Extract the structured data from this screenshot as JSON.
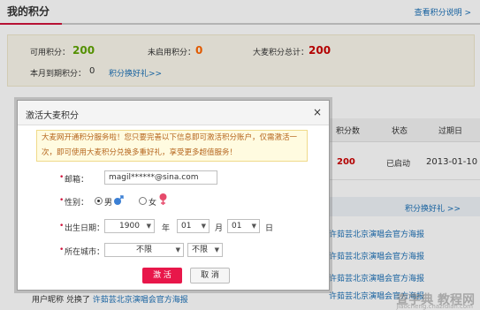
{
  "header": {
    "title": "我的积分",
    "help_link": "查看积分说明 >"
  },
  "summary": {
    "available_label": "可用积分：",
    "available_value": "200",
    "inactive_label": "未启用积分：",
    "inactive_value": "0",
    "total_label": "大麦积分总计：",
    "total_value": "200",
    "expire_label": "本月到期积分：",
    "expire_value": "0",
    "exchange_link": "积分换好礼>>"
  },
  "table": {
    "headers": [
      "积分数",
      "状态",
      "过期日"
    ],
    "row": {
      "points": "200",
      "status": "已启动",
      "expire": "2013-01-10"
    },
    "exchange_link": "积分换好礼 >>"
  },
  "feed": [
    {
      "prefix": "",
      "action": "",
      "item": "许茹芸北京演唱会官方海报"
    },
    {
      "prefix": "",
      "action": "",
      "item": "许茹芸北京演唱会官方海报"
    },
    {
      "prefix": "",
      "action": "",
      "item": "许茹芸北京演唱会官方海报"
    },
    {
      "prefix": "",
      "action": "",
      "item": "许茹芸北京演唱会官方海报"
    },
    {
      "prefix": "用户昵称",
      "action": "兑换了",
      "item": "许茹芸北京演唱会官方海报"
    }
  ],
  "dialog": {
    "title": "激活大麦积分",
    "close": "×",
    "notice": "大麦网开通积分服务啦！您只要完善以下信息即可激活积分账户，仅需激活一次，即可使用大麦积分兑换多重好礼，享受更多超值服务！",
    "email_label": "邮箱：",
    "email_value": "magil******@sina.com",
    "gender_label": "性别：",
    "male": "男",
    "female": "女",
    "birth_label": "出生日期：",
    "year_value": "1900",
    "year_unit": "年",
    "month_value": "01",
    "month_unit": "月",
    "day_value": "01",
    "day_unit": "日",
    "city_label": "所在城市：",
    "province_value": "不限",
    "city_value": "不限",
    "activate_button": "激 活",
    "cancel_button": "取 消"
  },
  "watermark": {
    "main": "查字典 教程网",
    "sub": "jiaocheng.chazidian.com"
  }
}
